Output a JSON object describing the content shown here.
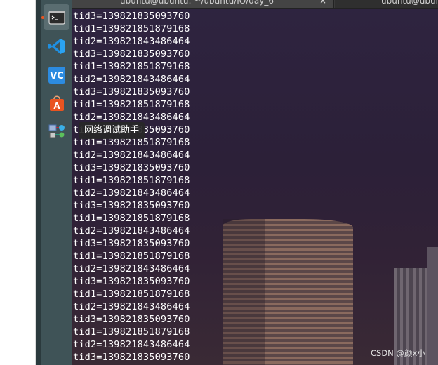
{
  "terminal": {
    "tabs": [
      {
        "title": "ubuntu@ubuntu: ~/ubuntu/IO/day_6",
        "close": "×"
      },
      {
        "title": "ubuntu@ubuntu: ~"
      }
    ],
    "lines": [
      "tid3=139821835093760",
      "tid1=139821851879168",
      "tid2=139821843486464",
      "tid3=139821835093760",
      "tid1=139821851879168",
      "tid2=139821843486464",
      "tid3=139821835093760",
      "tid1=139821851879168",
      "tid2=139821843486464",
      "tid3=139821835093760",
      "tid1=139821851879168",
      "tid2=139821843486464",
      "tid3=139821835093760",
      "tid1=139821851879168",
      "tid2=139821843486464",
      "tid3=139821835093760",
      "tid1=139821851879168",
      "tid2=139821843486464",
      "tid3=139821835093760",
      "tid1=139821851879168",
      "tid2=139821843486464",
      "tid3=139821835093760",
      "tid1=139821851879168",
      "tid2=139821843486464",
      "tid3=139821835093760",
      "tid1=139821851879168",
      "tid2=139821843486464",
      "tid3=139821835093760"
    ]
  },
  "dock": {
    "items": [
      {
        "name": "terminal",
        "icon": "terminal-icon",
        "active": true
      },
      {
        "name": "vscode",
        "icon": "vscode-icon"
      },
      {
        "name": "vnc-viewer",
        "icon": "vnc-icon"
      },
      {
        "name": "software-center",
        "icon": "shopping-bag-icon"
      },
      {
        "name": "network-debug-assistant",
        "icon": "network-icon"
      }
    ],
    "tooltip": "网络调试助手"
  },
  "watermark": "CSDN @颜x小",
  "colors": {
    "dock_bg": "#3f5357",
    "terminal_text": "#ffffff",
    "accent": "#e95420"
  }
}
